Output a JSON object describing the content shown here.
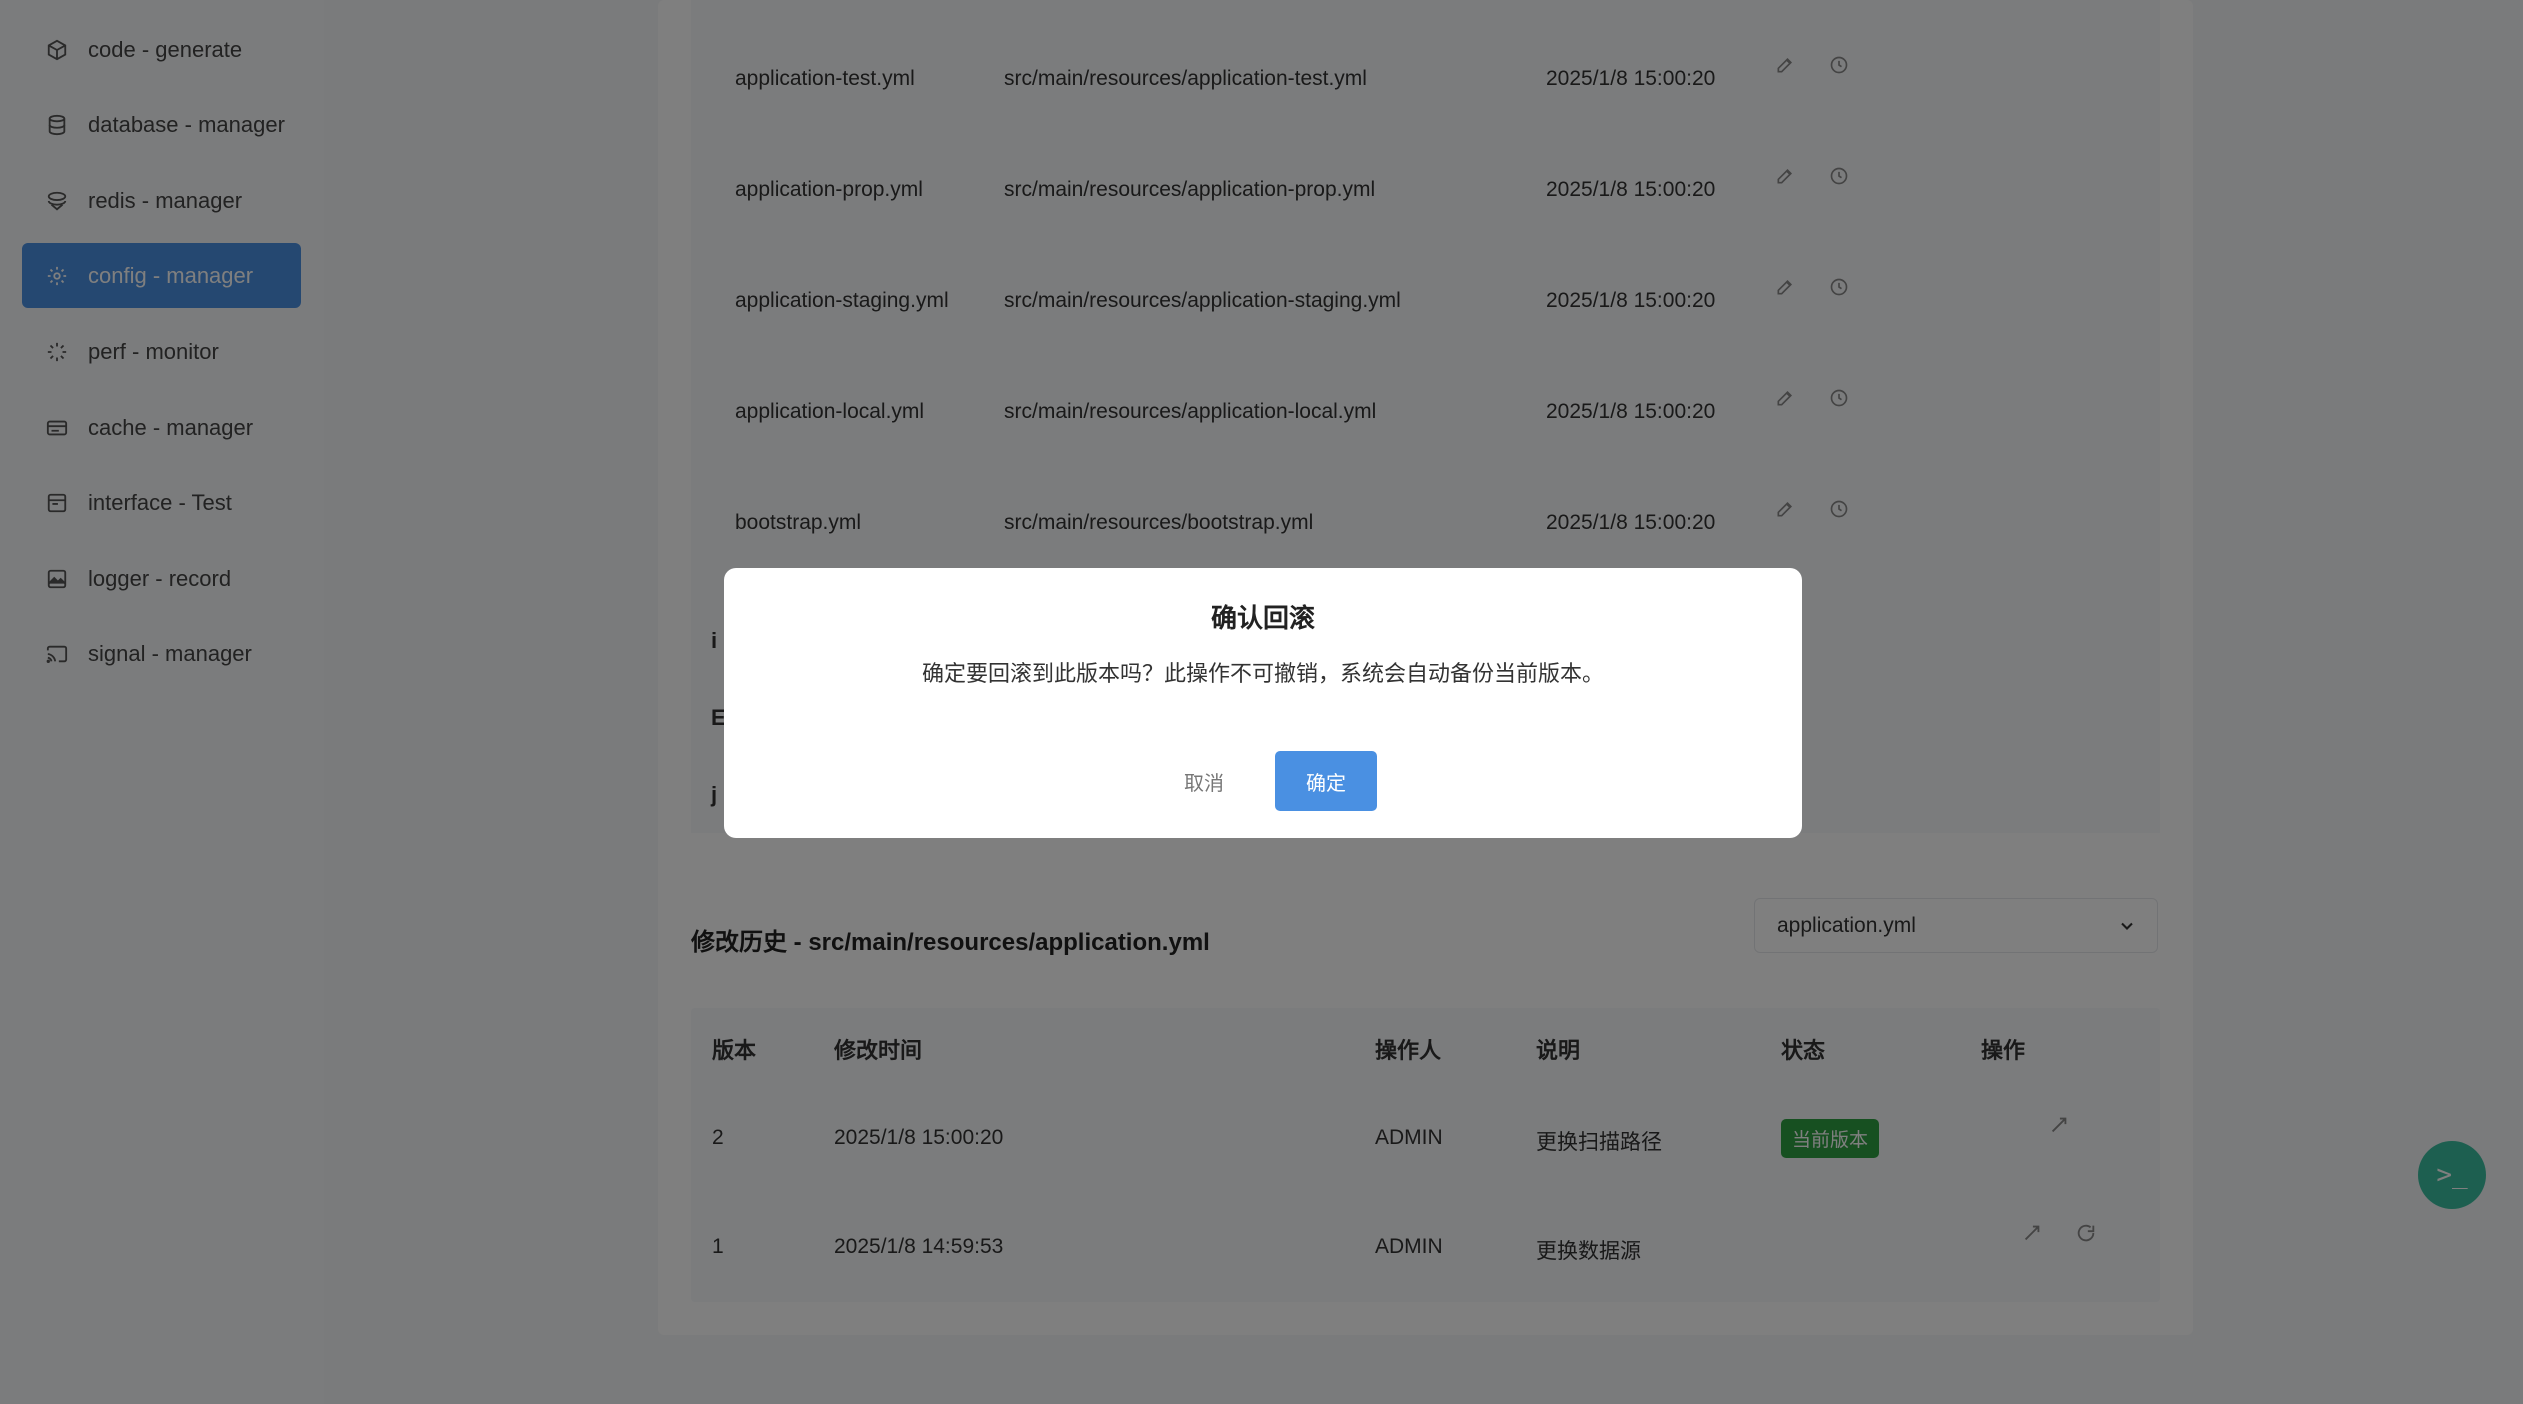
{
  "sidebar": {
    "items": [
      {
        "label": "code - generate",
        "icon": "cube-icon",
        "active": false
      },
      {
        "label": "database - manager",
        "icon": "database-icon",
        "active": false
      },
      {
        "label": "redis - manager",
        "icon": "layers-icon",
        "active": false
      },
      {
        "label": "config - manager",
        "icon": "gear-icon",
        "active": true
      },
      {
        "label": "perf - monitor",
        "icon": "spinner-icon",
        "active": false
      },
      {
        "label": "cache - manager",
        "icon": "card-icon",
        "active": false
      },
      {
        "label": "interface - Test",
        "icon": "window-icon",
        "active": false
      },
      {
        "label": "logger - record",
        "icon": "image-icon",
        "active": false
      },
      {
        "label": "signal - manager",
        "icon": "cast-icon",
        "active": false
      }
    ]
  },
  "files": {
    "rows": [
      {
        "name": "application-test.yml",
        "path": "src/main/resources/application-test.yml",
        "time": "2025/1/8 15:00:20"
      },
      {
        "name": "application-prop.yml",
        "path": "src/main/resources/application-prop.yml",
        "time": "2025/1/8 15:00:20"
      },
      {
        "name": "application-staging.yml",
        "path": "src/main/resources/application-staging.yml",
        "time": "2025/1/8 15:00:20"
      },
      {
        "name": "application-local.yml",
        "path": "src/main/resources/application-local.yml",
        "time": "2025/1/8 15:00:20"
      },
      {
        "name": "bootstrap.yml",
        "path": "src/main/resources/bootstrap.yml",
        "time": "2025/1/8 15:00:20"
      }
    ],
    "partial_labels": [
      "i",
      "E",
      "j"
    ]
  },
  "history": {
    "title": "修改历史 - src/main/resources/application.yml",
    "select_value": "application.yml",
    "headers": {
      "version": "版本",
      "time": "修改时间",
      "operator": "操作人",
      "desc": "说明",
      "status": "状态",
      "action": "操作"
    },
    "rows": [
      {
        "version": "2",
        "time": "2025/1/8 15:00:20",
        "operator": "ADMIN",
        "desc": "更换扫描路径",
        "status": "当前版本"
      },
      {
        "version": "1",
        "time": "2025/1/8 14:59:53",
        "operator": "ADMIN",
        "desc": "更换数据源",
        "status": ""
      }
    ]
  },
  "fab": {
    "label": ">_"
  },
  "dialog": {
    "title": "确认回滚",
    "message": "确定要回滚到此版本吗？此操作不可撤销，系统会自动备份当前版本。",
    "cancel_label": "取消",
    "ok_label": "确定"
  },
  "colors": {
    "accent": "#4a90e2",
    "success": "#2ea043",
    "fab": "#3bbfa0",
    "overlay": "rgba(0,0,0,0.5)"
  }
}
